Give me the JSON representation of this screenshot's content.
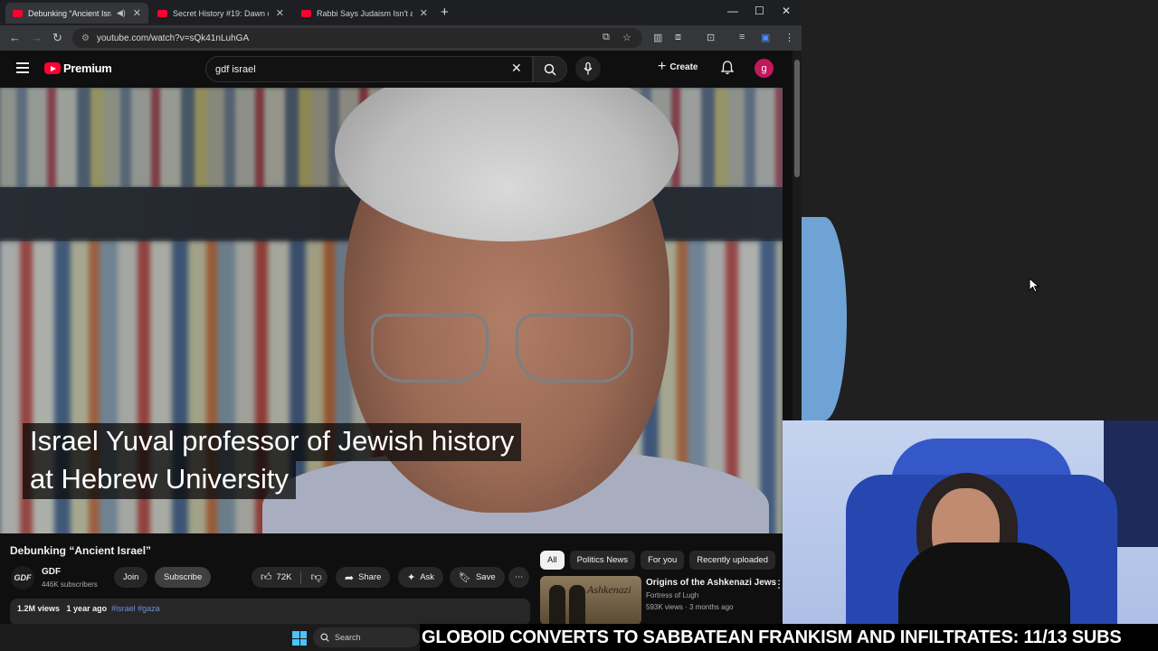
{
  "browser": {
    "tabs": [
      {
        "title": "Debunking “Ancient Israel”",
        "active": true
      },
      {
        "title": "Secret History #19: Dawn of the",
        "active": false
      },
      {
        "title": "Rabbi Says Judaism Isn't a Relig",
        "active": false
      }
    ],
    "url": "youtube.com/watch?v=sQk41nLuhGA"
  },
  "youtube": {
    "logo_text": "Premium",
    "search_value": "gdf israel",
    "create_label": "Create",
    "avatar_letter": "g"
  },
  "video": {
    "caption_line1": "Israel Yuval professor of Jewish history",
    "caption_line2": "at Hebrew University",
    "title": "Debunking “Ancient Israel”",
    "channel_logo_text": "GDF",
    "channel_name": "GDF",
    "subscribers": "446K subscribers",
    "join_label": "Join",
    "subscribe_label": "Subscribe",
    "likes": "72K",
    "share_label": "Share",
    "ask_label": "Ask",
    "save_label": "Save",
    "views": "1.2M views",
    "age": "1 year ago",
    "tags": "#israel #gaza"
  },
  "recommendations": {
    "chips": [
      "All",
      "Politics News",
      "For you",
      "Recently uploaded"
    ],
    "first": {
      "title": "Origins of the Ashkenazi Jews",
      "channel": "Fortress of Lugh",
      "meta": "593K views · 3 months ago",
      "thumb_text": "Ashkenazi"
    }
  },
  "taskbar": {
    "search_label": "Search"
  },
  "ticker": {
    "text": "GLOBOID CONVERTS TO SABBATEAN FRANKISM AND INFILTRATES: 11/13 SUBS"
  },
  "colors": {
    "youtube_red": "#ff0033",
    "avatar": "#c2185b",
    "webcam_chair": "#2747b0"
  }
}
